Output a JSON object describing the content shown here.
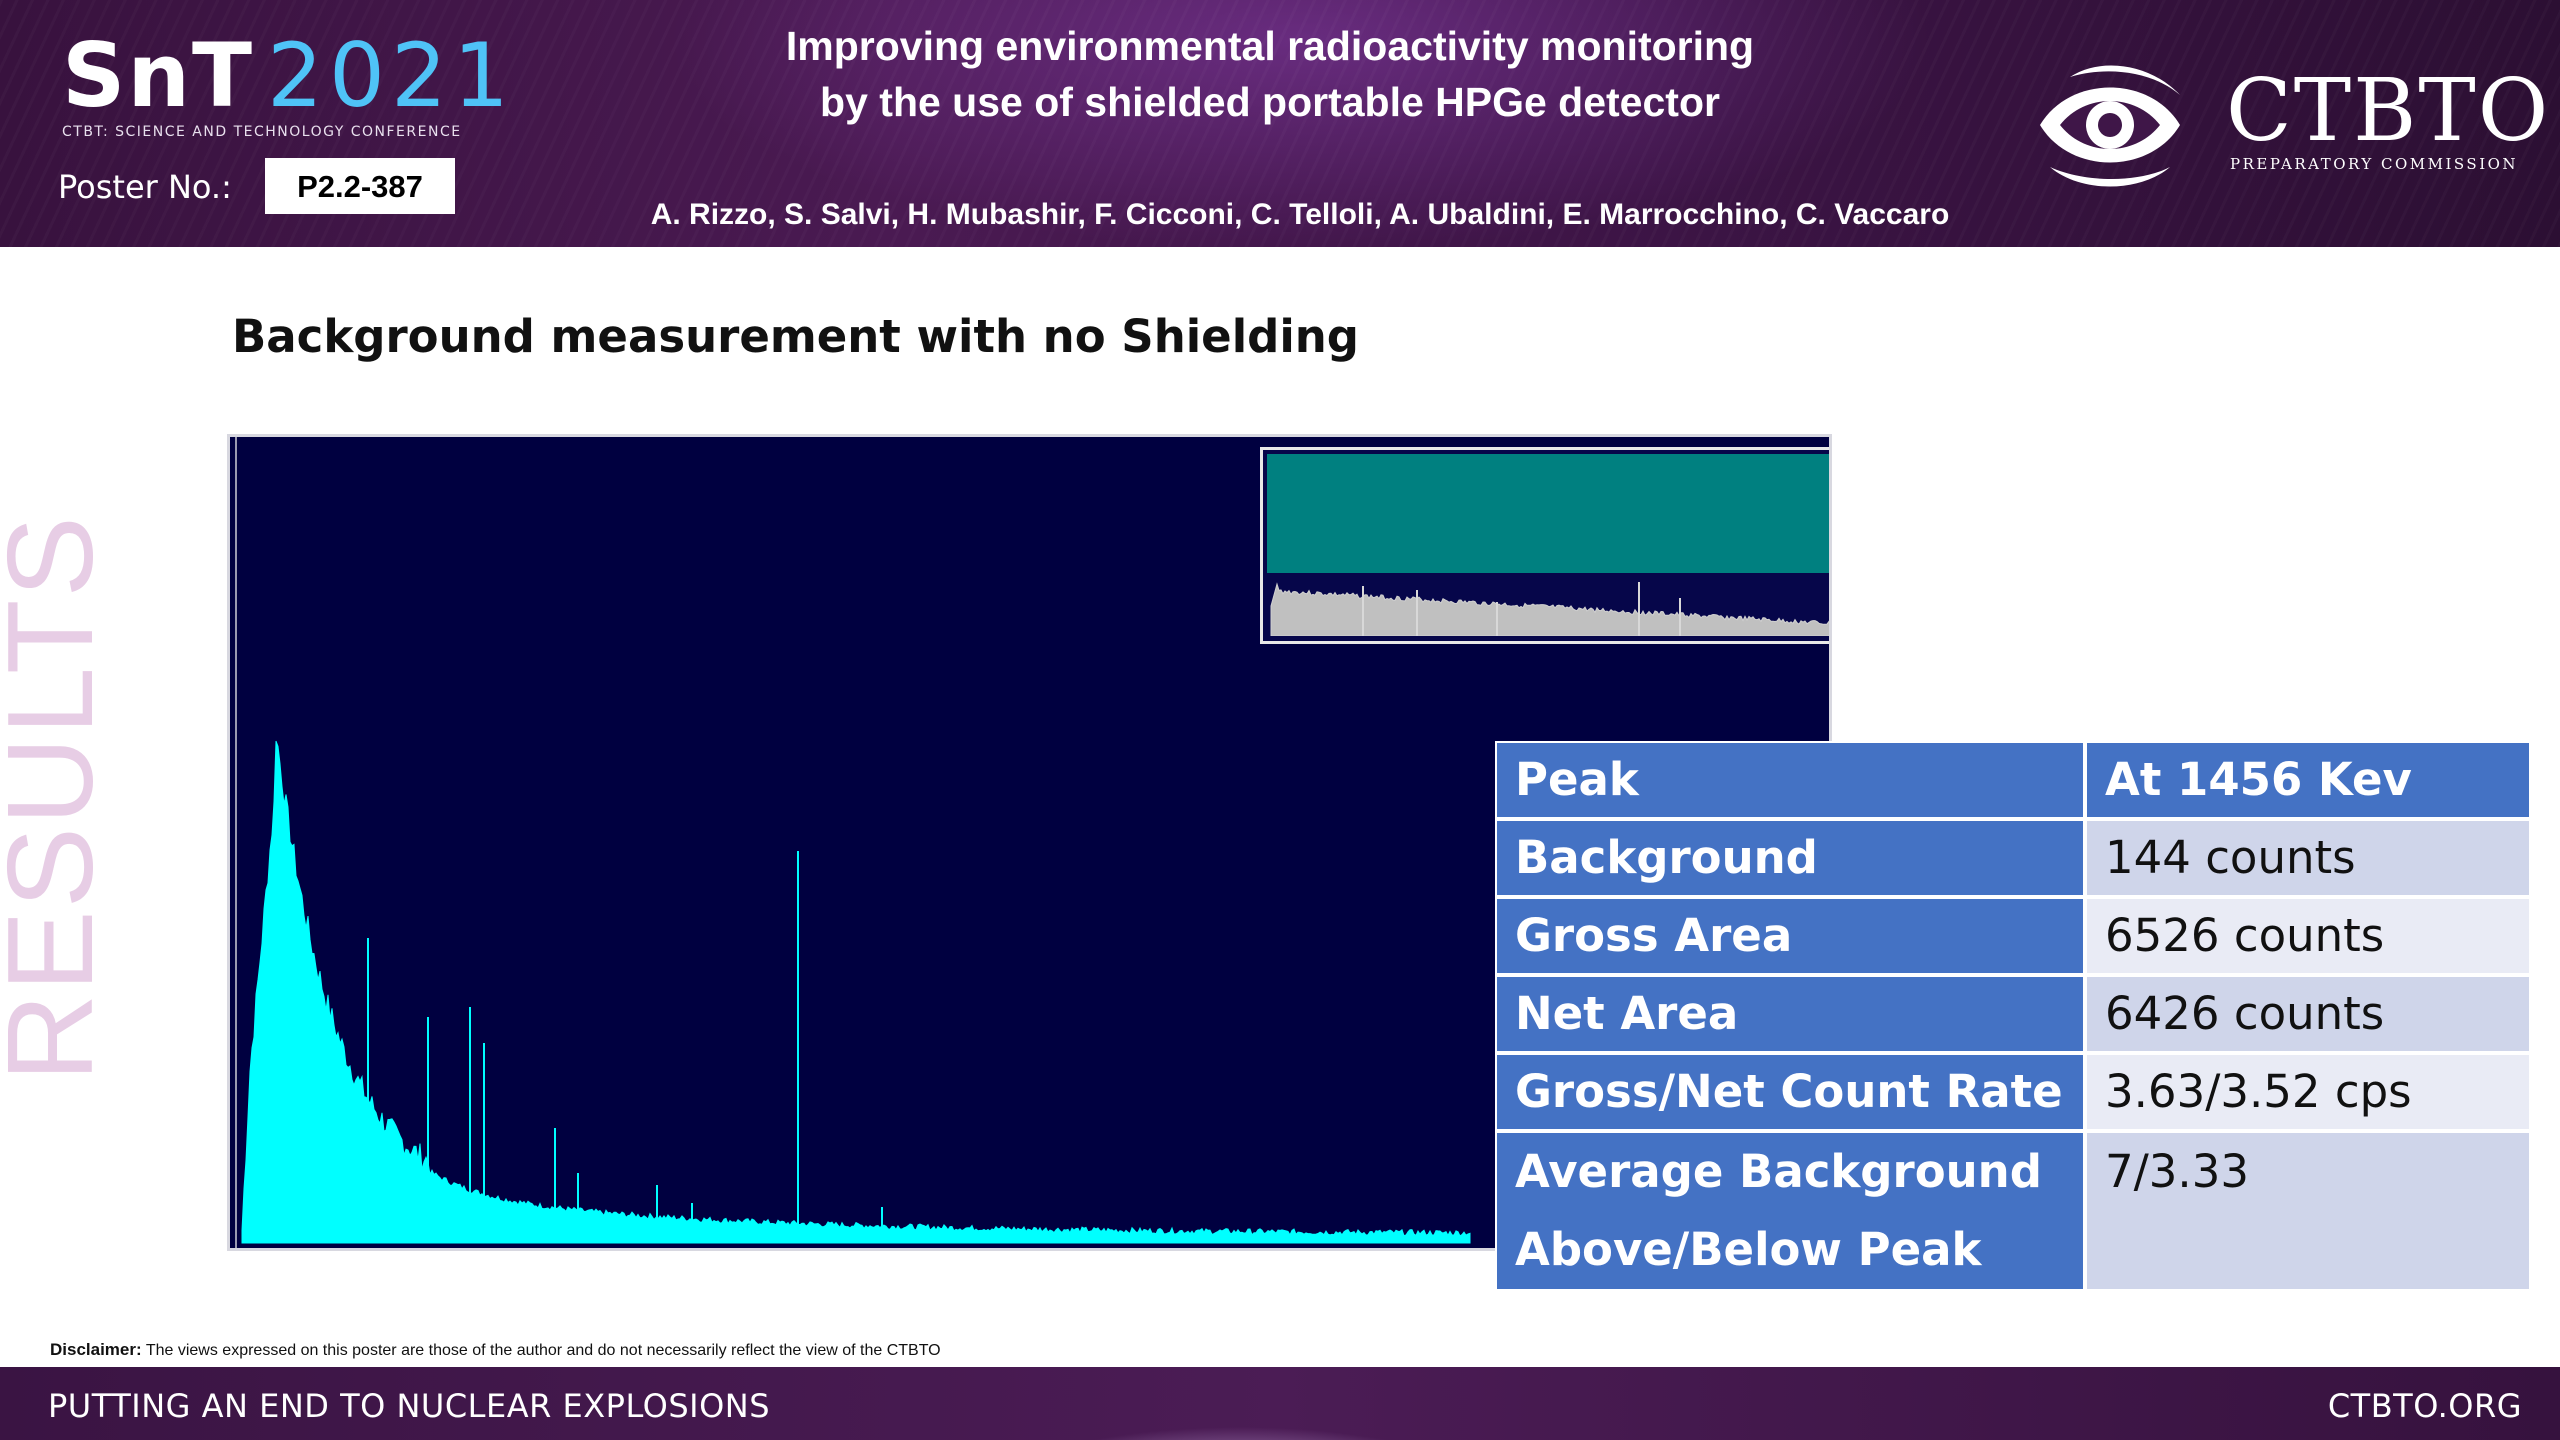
{
  "header": {
    "logo": {
      "brand": "SnT",
      "year": "2021",
      "subtitle": "CTBT: SCIENCE AND TECHNOLOGY CONFERENCE"
    },
    "poster_label": "Poster No.:",
    "poster_number": "P2.2-387",
    "title_line1": "Improving environmental radioactivity monitoring",
    "title_line2": "by the use of shielded portable HPGe detector",
    "authors": "A. Rizzo, S. Salvi, H. Mubashir, F. Cicconi, C. Telloli, A. Ubaldini, E. Marrocchino, C. Vaccaro",
    "org_logo": {
      "name": "CTBTO",
      "subtitle": "PREPARATORY COMMISSION"
    }
  },
  "side_label": "RESULTS",
  "section_heading": "Background measurement with no Shielding",
  "colors": {
    "header_bg": "#3f1648",
    "spectrum_bg": "#000040",
    "spectrum_fill": "#00ffff",
    "inset_teal": "#008080",
    "inset_spectrum": "#c0c0c0",
    "table_header": "#4472c4",
    "table_row_dark": "#cfd5ea",
    "table_row_light": "#e9ebf5",
    "results_text": "#e7cde5"
  },
  "table": {
    "header": {
      "label": "Peak",
      "value": "At 1456 Kev"
    },
    "rows": [
      {
        "label": "Background",
        "value": "144 counts"
      },
      {
        "label": "Gross Area",
        "value": "6526 counts"
      },
      {
        "label": "Net Area",
        "value": "6426 counts"
      },
      {
        "label": "Gross/Net Count Rate",
        "value": "3.63/3.52 cps"
      },
      {
        "label_line1": "Average Background",
        "label_line2": "Above/Below Peak",
        "value": "7/3.33"
      }
    ]
  },
  "disclaimer": {
    "label": "Disclaimer:",
    "text": "The views expressed on this poster are those of the author and do not necessarily reflect the view of the CTBTO"
  },
  "footer": {
    "left": "PUTTING AN END TO NUCLEAR EXPLOSIONS",
    "right": "CTBTO.ORG"
  }
}
